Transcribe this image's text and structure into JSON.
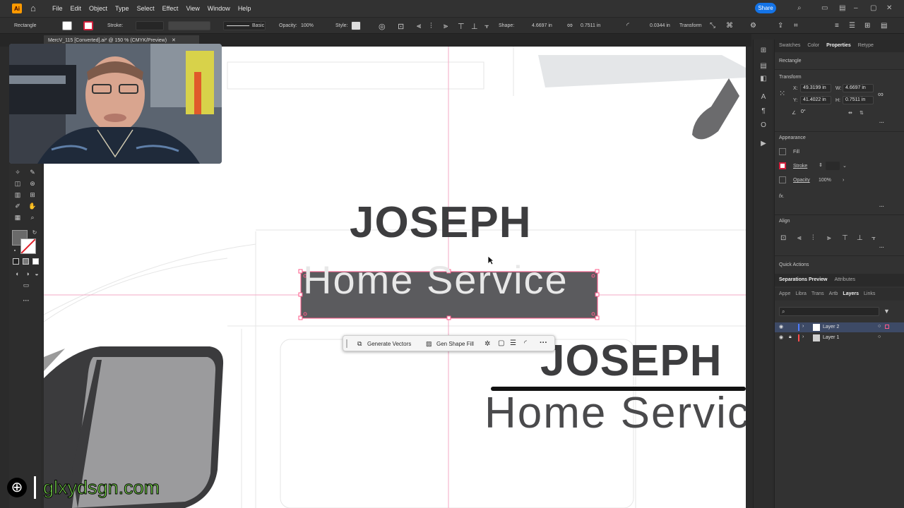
{
  "menubar": {
    "app_logo": "Ai",
    "menus": [
      "File",
      "Edit",
      "Object",
      "Type",
      "Select",
      "Effect",
      "View",
      "Window",
      "Help"
    ],
    "share_label": "Share",
    "icons": [
      "home-icon",
      "search-icon",
      "workspace-icon",
      "arrange-icon"
    ]
  },
  "control_bar": {
    "object_type": "Rectangle",
    "stroke_label": "Stroke:",
    "stroke_style": "Basic",
    "opacity_label": "Opacity:",
    "opacity_value": "100%",
    "style_label": "Style:",
    "shape_label": "Shape:",
    "width_value": "4.6697 in",
    "height_value": "0.7511 in",
    "corner_value": "0.0344 in",
    "transform_label": "Transform"
  },
  "document": {
    "tab_title": "MercV_115 [Converted].ai* @ 150 % (CMYK/Preview)"
  },
  "canvas": {
    "headline_1": "JOSEPH",
    "subline_1": "Home Service",
    "headline_2": "JOSEPH",
    "subline_2": "Home Servic"
  },
  "taskbar": {
    "generate_vectors": "Generate Vectors",
    "gen_shape_fill": "Gen Shape Fill"
  },
  "properties_panel": {
    "tabs": [
      "Swatches",
      "Color",
      "Properties",
      "Retype"
    ],
    "active_tab": "Properties",
    "object_type": "Rectangle",
    "transform_title": "Transform",
    "x_label": "X:",
    "x_value": "49.3199 in",
    "y_label": "Y:",
    "y_value": "41.4022 in",
    "w_label": "W:",
    "w_value": "4.6697 in",
    "h_label": "H:",
    "h_value": "0.7511 in",
    "angle_value": "0°",
    "appearance_title": "Appearance",
    "fill_label": "Fill",
    "stroke_label": "Stroke",
    "opacity_label": "Opacity",
    "opacity_value": "100%",
    "fx_label": "fx.",
    "align_title": "Align",
    "quick_actions_title": "Quick Actions"
  },
  "layers_panel": {
    "top_tabs": [
      "Separations Preview",
      "Attributes"
    ],
    "tabs": [
      "Appe",
      "Libra",
      "Trans",
      "Artb",
      "Layers",
      "Links"
    ],
    "active_tab": "Layers",
    "layers": [
      {
        "name": "Layer 2",
        "color": "#4f7cff",
        "selected": true,
        "locked": false
      },
      {
        "name": "Layer 1",
        "color": "#ff4d4d",
        "selected": false,
        "locked": true
      }
    ]
  },
  "watermark": {
    "text": "glxydsgn.com"
  },
  "colors": {
    "accent": "#1473e6",
    "selection": "#ff5a8a",
    "text_dark": "#3d3d3f",
    "rect_fill": "#5b5b5e",
    "watermark_green": "#78d84b"
  }
}
